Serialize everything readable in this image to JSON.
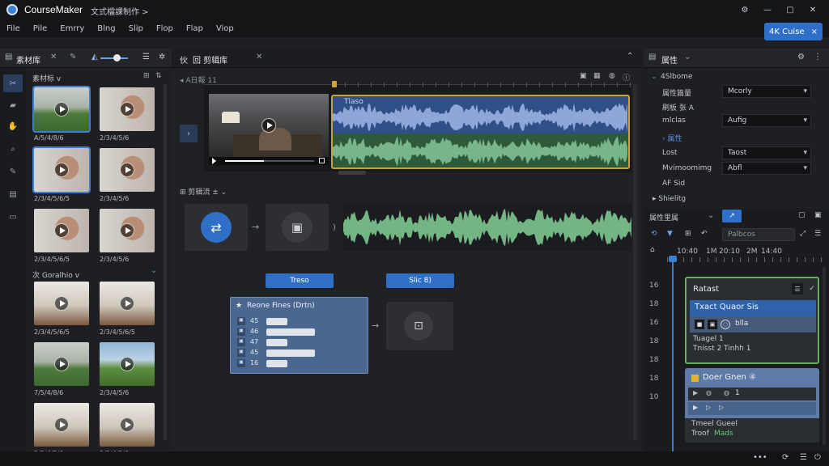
{
  "app": {
    "title": "CourseMaker",
    "subtitle": "文式檔課制作 >",
    "accent": "#3c7fd6"
  },
  "menu": {
    "items": [
      "File",
      "Pile",
      "Emrry",
      "Blng",
      "Slip",
      "Flop",
      "Flap",
      "Viop"
    ]
  },
  "topbutton": {
    "label": "4K Cuise",
    "close": "×"
  },
  "library": {
    "tab": "素材库",
    "section_label": "素材标 v",
    "subfolder": "次 Goralhio v",
    "items": [
      {
        "label": "A/5/4/8/6",
        "scene": "lawn",
        "selected": true
      },
      {
        "label": "2/3/4/5/6",
        "scene": "woman",
        "selected": false
      },
      {
        "label": "2/3/4/5/6/5",
        "scene": "woman",
        "selected": true
      },
      {
        "label": "2/3/4/5/6",
        "scene": "woman",
        "selected": false
      },
      {
        "label": "2/3/4/5/6/5",
        "scene": "woman",
        "selected": false
      },
      {
        "label": "2/3/4/5/6",
        "scene": "woman",
        "selected": false
      },
      {
        "label": "2/3/4/5/6/5",
        "scene": "room",
        "selected": false
      },
      {
        "label": "2/3/4/5/6/5",
        "scene": "room",
        "selected": false
      },
      {
        "label": "7/5/4/8/6",
        "scene": "lawn",
        "selected": false
      },
      {
        "label": "2/3/4/5/6",
        "scene": "park",
        "selected": false
      },
      {
        "label": "2/3/4/5/6",
        "scene": "room",
        "selected": false
      },
      {
        "label": "2/3/4/5/6",
        "scene": "room",
        "selected": false
      }
    ]
  },
  "editor": {
    "tab": "回 剪辑库",
    "tab_prefix": "伙",
    "breadcrumb": "◂ A日報 11",
    "audio_label": "Tlaso",
    "section2": "⊞ 剪辑流 ± ⌄",
    "pill_left": "Treso",
    "pill_right": "Slic 8)",
    "card_title": "Reone Fines (Drtn)",
    "card_rows": [
      "45",
      "46",
      "47",
      "45",
      "16"
    ],
    "arrow": "→",
    "arrow2": ")"
  },
  "properties": {
    "tab": "属性",
    "group": "4Slbome",
    "rows": [
      {
        "label": "属性篇量",
        "value": "Mcorly"
      },
      {
        "label": "刷板 张 A",
        "value": ""
      },
      {
        "label": "mlclas",
        "value": "Aufig"
      },
      {
        "label": "属性",
        "value": ""
      },
      {
        "label": "Lost",
        "value": "Taost"
      },
      {
        "label": "Mvimoomimg",
        "value": "Abfl"
      },
      {
        "label": "AF Sid",
        "value": ""
      },
      {
        "label": "Shielitg",
        "value": ""
      }
    ],
    "timeline_tab": "属性里属",
    "timeline_input": "Palbcos",
    "ruler": [
      "10:40",
      "1M",
      "20:10",
      "2M",
      "14:40"
    ],
    "rows_numbers": [
      "16",
      "18",
      "16",
      "18",
      "18",
      "18",
      "10"
    ],
    "clip1": {
      "title": "Ratast",
      "highlight": "Txact Quaor Sis",
      "sub": "blla",
      "line1": "Tuagel 1",
      "line2": "Tnisst 2 Tinhh 1"
    },
    "clip2": {
      "title": "Doer Gnen ④",
      "row1": "1",
      "line1": "Tmeel Gueel",
      "line2": "Troof",
      "line2b": "Mads"
    }
  }
}
